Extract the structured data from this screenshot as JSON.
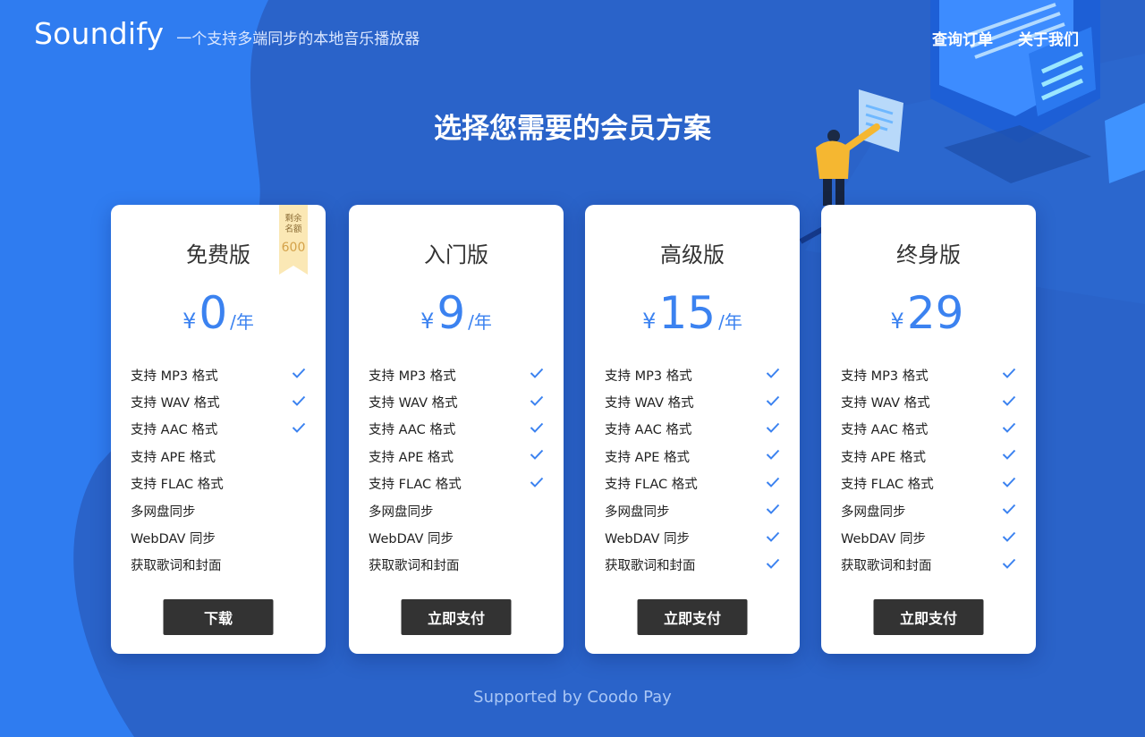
{
  "brand": {
    "name": "Soundify",
    "tagline": "一个支持多端同步的本地音乐播放器"
  },
  "nav": {
    "items": [
      "查询订单",
      "关于我们"
    ]
  },
  "headline": "选择您需要的会员方案",
  "currency_symbol": "¥",
  "plans": [
    {
      "name": "免费版",
      "price": "0",
      "period": "/年",
      "button": "下载",
      "ribbon": {
        "label": "剩余名额",
        "count": "600"
      },
      "features": [
        {
          "label": "支持 MP3 格式",
          "included": true
        },
        {
          "label": "支持 WAV 格式",
          "included": true
        },
        {
          "label": "支持 AAC 格式",
          "included": true
        },
        {
          "label": "支持 APE 格式",
          "included": false
        },
        {
          "label": "支持 FLAC 格式",
          "included": false
        },
        {
          "label": "多网盘同步",
          "included": false
        },
        {
          "label": "WebDAV 同步",
          "included": false
        },
        {
          "label": "获取歌词和封面",
          "included": false
        }
      ]
    },
    {
      "name": "入门版",
      "price": "9",
      "period": "/年",
      "button": "立即支付",
      "features": [
        {
          "label": "支持 MP3 格式",
          "included": true
        },
        {
          "label": "支持 WAV 格式",
          "included": true
        },
        {
          "label": "支持 AAC 格式",
          "included": true
        },
        {
          "label": "支持 APE 格式",
          "included": true
        },
        {
          "label": "支持 FLAC 格式",
          "included": true
        },
        {
          "label": "多网盘同步",
          "included": false
        },
        {
          "label": "WebDAV 同步",
          "included": false
        },
        {
          "label": "获取歌词和封面",
          "included": false
        }
      ]
    },
    {
      "name": "高级版",
      "price": "15",
      "period": "/年",
      "button": "立即支付",
      "features": [
        {
          "label": "支持 MP3 格式",
          "included": true
        },
        {
          "label": "支持 WAV 格式",
          "included": true
        },
        {
          "label": "支持 AAC 格式",
          "included": true
        },
        {
          "label": "支持 APE 格式",
          "included": true
        },
        {
          "label": "支持 FLAC 格式",
          "included": true
        },
        {
          "label": "多网盘同步",
          "included": true
        },
        {
          "label": "WebDAV 同步",
          "included": true
        },
        {
          "label": "获取歌词和封面",
          "included": true
        }
      ]
    },
    {
      "name": "终身版",
      "price": "29",
      "period": "",
      "button": "立即支付",
      "features": [
        {
          "label": "支持 MP3 格式",
          "included": true
        },
        {
          "label": "支持 WAV 格式",
          "included": true
        },
        {
          "label": "支持 AAC 格式",
          "included": true
        },
        {
          "label": "支持 APE 格式",
          "included": true
        },
        {
          "label": "支持 FLAC 格式",
          "included": true
        },
        {
          "label": "多网盘同步",
          "included": true
        },
        {
          "label": "WebDAV 同步",
          "included": true
        },
        {
          "label": "获取歌词和封面",
          "included": true
        }
      ]
    }
  ],
  "footer": "Supported by Coodo Pay",
  "colors": {
    "background": "#2f7cf0",
    "accent": "#3b82f0",
    "button": "#333333"
  }
}
